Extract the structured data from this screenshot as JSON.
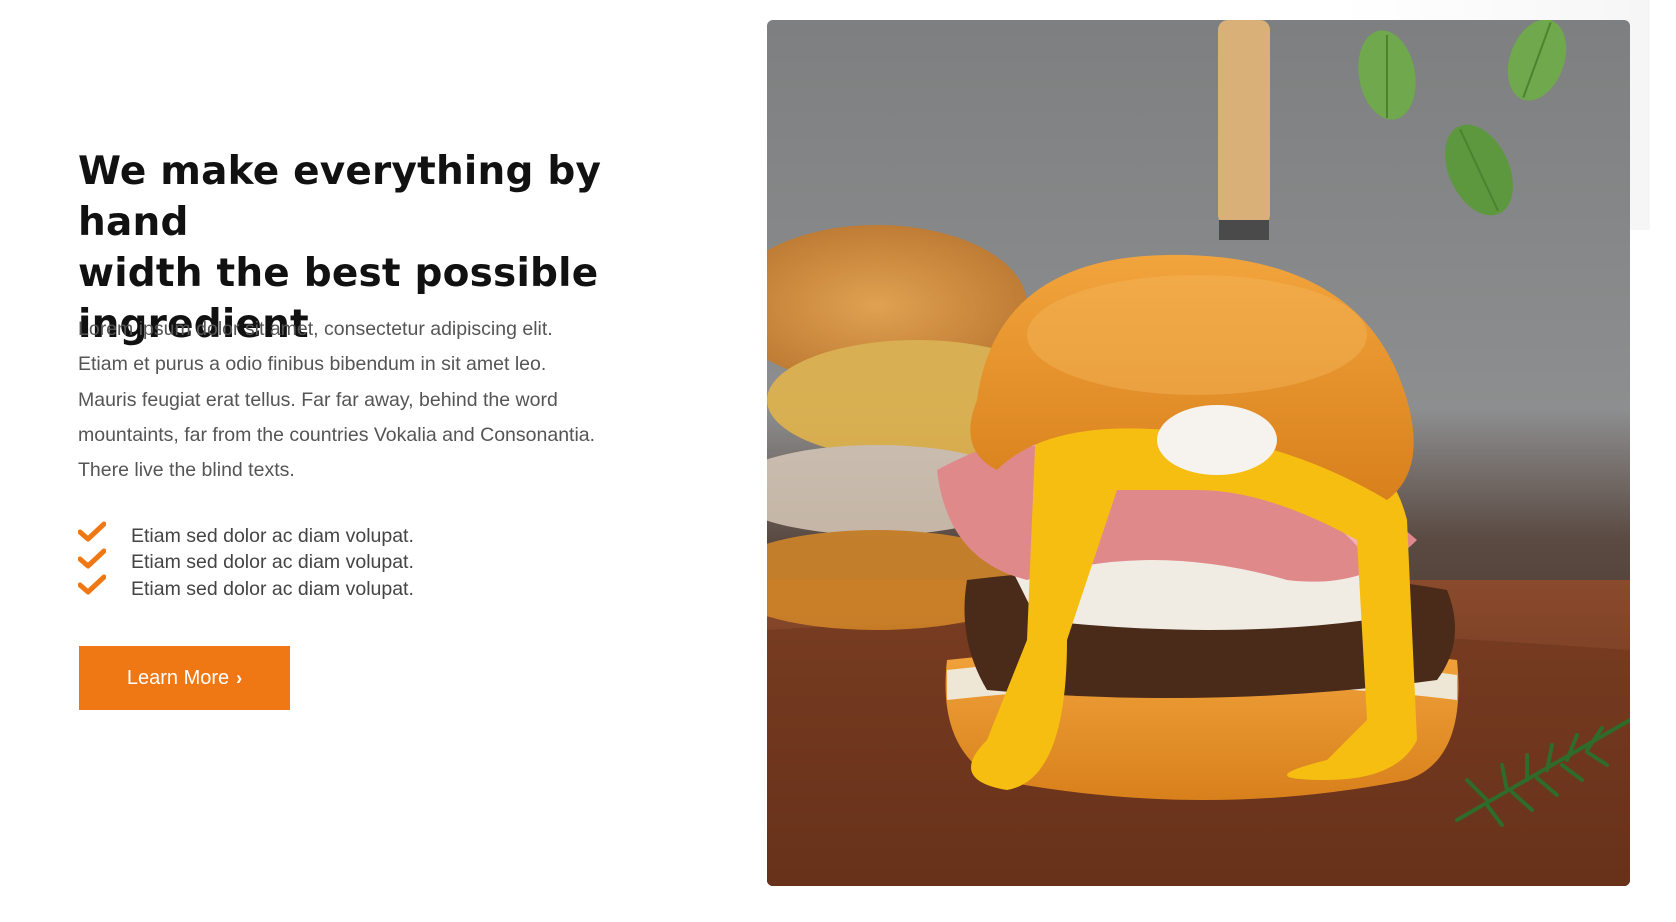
{
  "section": {
    "heading_lines": [
      "We make everything by hand",
      "width the best possible",
      "ingredient"
    ],
    "body_lines": [
      "Lorem ipsum dolor sit amet, consectetur adipiscing elit.",
      "Etiam et purus a odio finibus bibendum in sit amet leo.",
      "Mauris feugiat erat tellus. Far far away, behind the word",
      "mountaints, far from the countries Vokalia and Consonantia.",
      "There live the blind texts."
    ],
    "checklist": [
      {
        "label": "Etiam sed dolor ac diam volupat.",
        "icon": "check-icon"
      },
      {
        "label": "Etiam sed dolor ac diam volupat.",
        "icon": "check-icon"
      },
      {
        "label": "Etiam sed dolor ac diam volupat.",
        "icon": "check-icon"
      }
    ],
    "cta": {
      "label": "Learn More",
      "icon": "chevron-right-icon"
    },
    "image": {
      "subject": "burger-photo"
    }
  },
  "colors": {
    "accent": "#f07814",
    "heading": "#111111",
    "body": "#555555"
  }
}
